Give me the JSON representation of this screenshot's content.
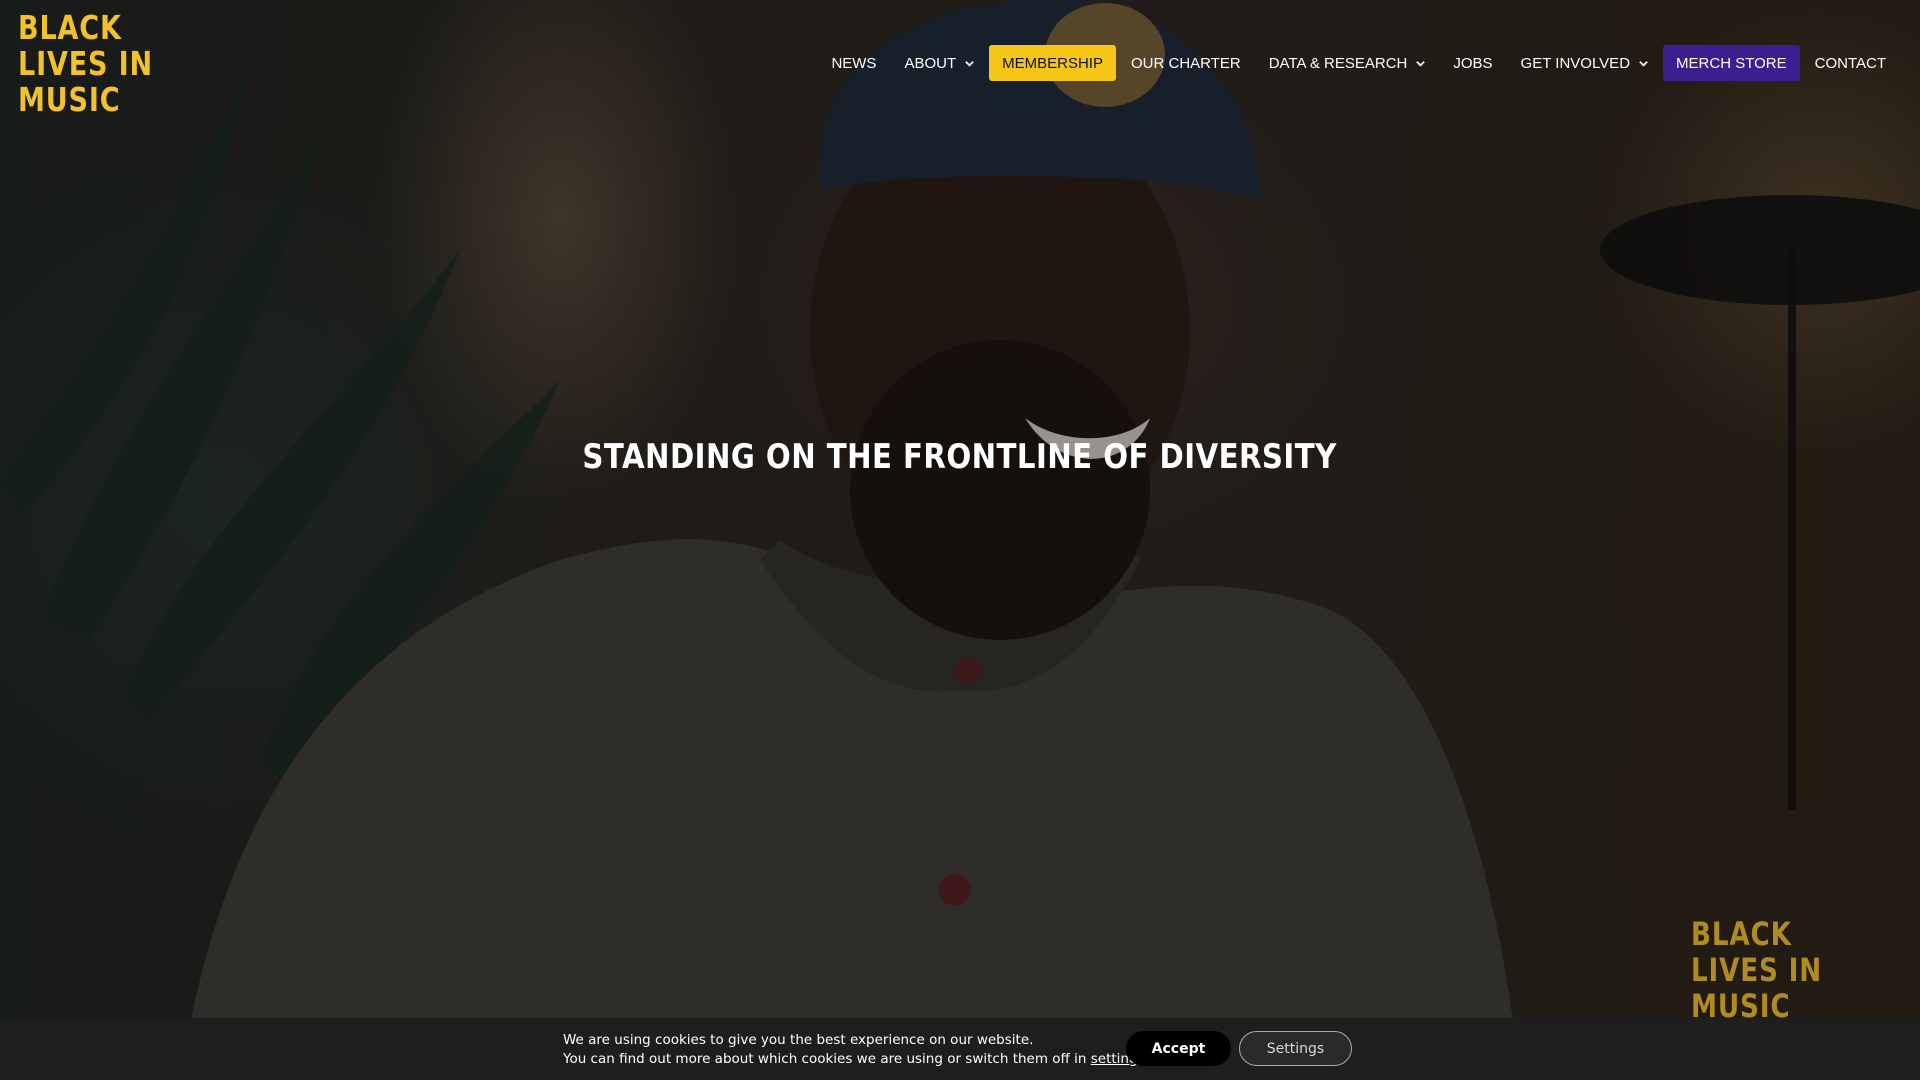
{
  "logo": {
    "lines": [
      "BLACK",
      "LIVES IN",
      "MUSIC"
    ]
  },
  "nav": {
    "items": [
      {
        "label": "NEWS"
      },
      {
        "label": "ABOUT"
      },
      {
        "label": "MEMBERSHIP"
      },
      {
        "label": "OUR CHARTER"
      },
      {
        "label": "DATA & RESEARCH"
      },
      {
        "label": "JOBS"
      },
      {
        "label": "GET INVOLVED"
      },
      {
        "label": "MERCH STORE"
      },
      {
        "label": "CONTACT"
      }
    ],
    "highlight_color": "#f5c518",
    "store_color": "#3d1e8f"
  },
  "hero": {
    "headline": "STANDING ON THE FRONTLINE OF DIVERSITY",
    "watermark_lines": [
      "BLACK",
      "LIVES IN",
      "MUSIC"
    ]
  },
  "cookie": {
    "line1": "We are using cookies to give you the best experience on our website.",
    "line2_prefix": "You can find out more about which cookies we are using or switch them off in ",
    "settings_link": "settings",
    "line2_suffix": ".",
    "accept_label": "Accept",
    "settings_label": "Settings"
  },
  "colors": {
    "brand_yellow": "#f2c12e"
  }
}
